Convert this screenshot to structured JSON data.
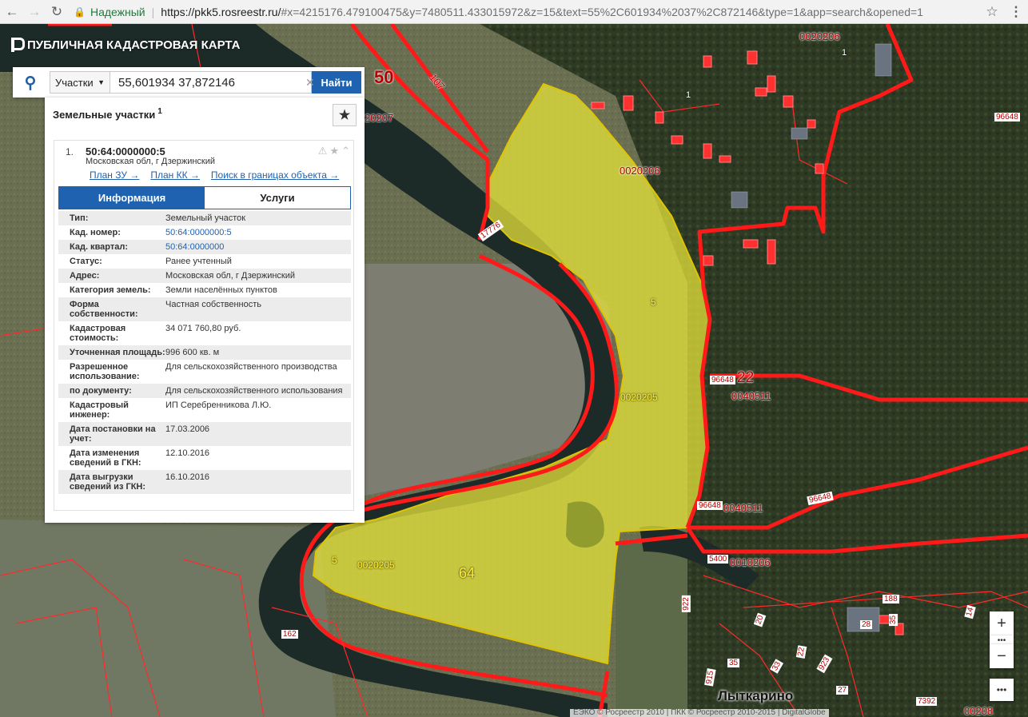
{
  "browser": {
    "secure_label": "Надежный",
    "url_host": "https://pkk5.rosreestr.ru/",
    "url_rest": "#x=4215176.479100475&y=7480511.433015972&z=15&text=55%2C601934%2037%2C872146&type=1&app=search&opened=1"
  },
  "app": {
    "title": "ПУБЛИЧНАЯ КАДАСТРОВАЯ КАРТА"
  },
  "search": {
    "type_label": "Участки",
    "query": "55,601934 37,872146",
    "find_label": "Найти"
  },
  "results": {
    "heading": "Земельные участки",
    "count": "1",
    "item": {
      "index": "1.",
      "cad_number": "50:64:0000000:5",
      "address": "Московская обл, г Дзержинский",
      "links": [
        "План ЗУ →",
        "План КК →",
        "Поиск в границах объекта →"
      ],
      "tabs": [
        "Информация",
        "Услуги"
      ],
      "properties": [
        {
          "key": "Тип:",
          "value": "Земельный участок"
        },
        {
          "key": "Кад. номер:",
          "value": "50:64:0000000:5",
          "link": true
        },
        {
          "key": "Кад. квартал:",
          "value": "50:64:0000000",
          "link": true
        },
        {
          "key": "Статус:",
          "value": "Ранее учтенный"
        },
        {
          "key": "Адрес:",
          "value": "Московская обл, г Дзержинский"
        },
        {
          "key": "Категория земель:",
          "value": "Земли населённых пунктов"
        },
        {
          "key": "Форма собственности:",
          "value": "Частная собственность"
        },
        {
          "key": "Кадастровая стоимость:",
          "value": "34 071 760,80 руб."
        },
        {
          "key": "Уточненная площадь:",
          "value": "996 600 кв. м"
        },
        {
          "key": "Разрешенное использование:",
          "value": "Для сельскохозяйственного производства"
        },
        {
          "key": "по документу:",
          "value": "Для сельскохозяйственного использования"
        },
        {
          "key": "Кадастровый инженер:",
          "value": "ИП Серебренникова Л.Ю."
        },
        {
          "key": "Дата постановки на учет:",
          "value": "17.03.2006"
        },
        {
          "key": "Дата изменения сведений в ГКН:",
          "value": "12.10.2016"
        },
        {
          "key": "Дата выгрузки сведений из ГКН:",
          "value": "16.10.2016"
        }
      ]
    }
  },
  "map": {
    "labels": {
      "l50": "50",
      "l107": "107",
      "l0020206a": "0020206",
      "l1a": "1",
      "l1b": "1",
      "l20207": "20207",
      "l0020206b": "0020206",
      "l96648a": "96648",
      "l17776": "17776",
      "l5a": "5",
      "l0020205a": "0020205",
      "l96648b": "96648",
      "l22": "22",
      "l0040511a": "0040511",
      "l96648c": "96648",
      "l0040511b": "0040511",
      "l96648d": "96648",
      "l5400": "5400",
      "l0010206": "0010206",
      "l5b": "5",
      "l0020205b": "0020205",
      "l64": "64",
      "l922": "922",
      "l162": "162",
      "l188": "188",
      "l35a": "35",
      "l28": "28",
      "l20": "20",
      "l35b": "35",
      "l33": "33",
      "l22b": "22",
      "l923": "923",
      "l27": "27",
      "l915": "915",
      "l7392": "7392",
      "l14": "14",
      "city": "Лыткарино",
      "l00208": "00208"
    },
    "attribution": "ЕЭКО © Росреестр 2010 | ПКК © Росреестр 2010-2015 | DigitalGlobe"
  },
  "colors": {
    "parcel_fill": "#e6e33a",
    "boundary": "#ff1a1a",
    "accent": "#1e62b0"
  }
}
